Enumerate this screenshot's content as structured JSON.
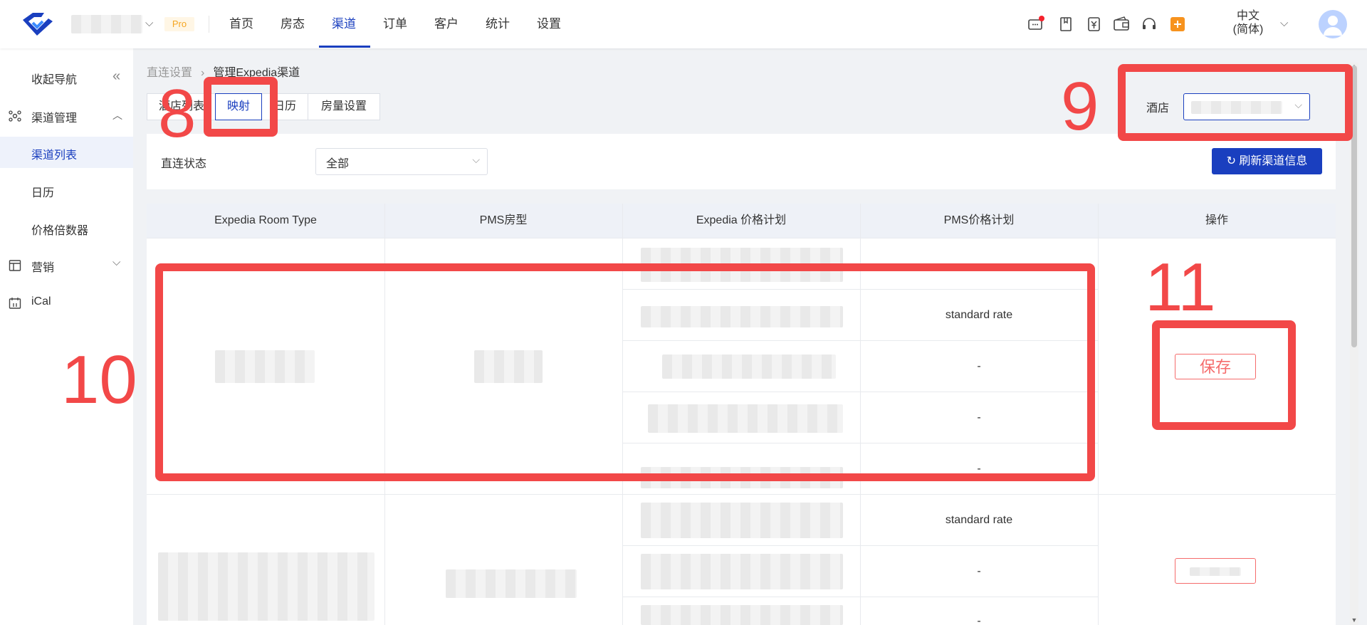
{
  "header": {
    "pro_badge": "Pro",
    "nav": [
      "首页",
      "房态",
      "渠道",
      "订单",
      "客户",
      "统计",
      "设置"
    ],
    "active_nav_index": 2,
    "language_line1": "中文",
    "language_line2": "(简体)",
    "accent_color": "#1a3fbf"
  },
  "sidebar": {
    "collapse_label": "收起导航",
    "items": [
      {
        "label": "渠道管理",
        "icon": "channel-network-icon"
      },
      {
        "label": "渠道列表",
        "active": true
      },
      {
        "label": "日历"
      },
      {
        "label": "价格倍数器"
      },
      {
        "label": "营销",
        "icon": "marketing-layout-icon"
      },
      {
        "label": "iCal",
        "icon": "calendar-icon"
      }
    ]
  },
  "breadcrumb": {
    "parent": "直连设置",
    "current": "管理Expedia渠道"
  },
  "tabs": [
    "酒店列表",
    "映射",
    "日历",
    "房量设置"
  ],
  "active_tab_index": 1,
  "filter": {
    "status_label": "直连状态",
    "status_value": "全部",
    "refresh_label": "刷新渠道信息"
  },
  "hotel_label": "酒店",
  "table": {
    "headers": [
      "Expedia Room Type",
      "PMS房型",
      "Expedia 价格计划",
      "PMS价格计划",
      "操作"
    ],
    "group1": {
      "pms_rate_plans": [
        "standard rate",
        "-",
        "-",
        "-"
      ],
      "action": "保存"
    },
    "group2": {
      "pms_rate_plans": [
        "standard rate",
        "-",
        "-"
      ]
    }
  },
  "annotations": [
    "8",
    "9",
    "10",
    "11"
  ],
  "annotation_color": "#f24848"
}
